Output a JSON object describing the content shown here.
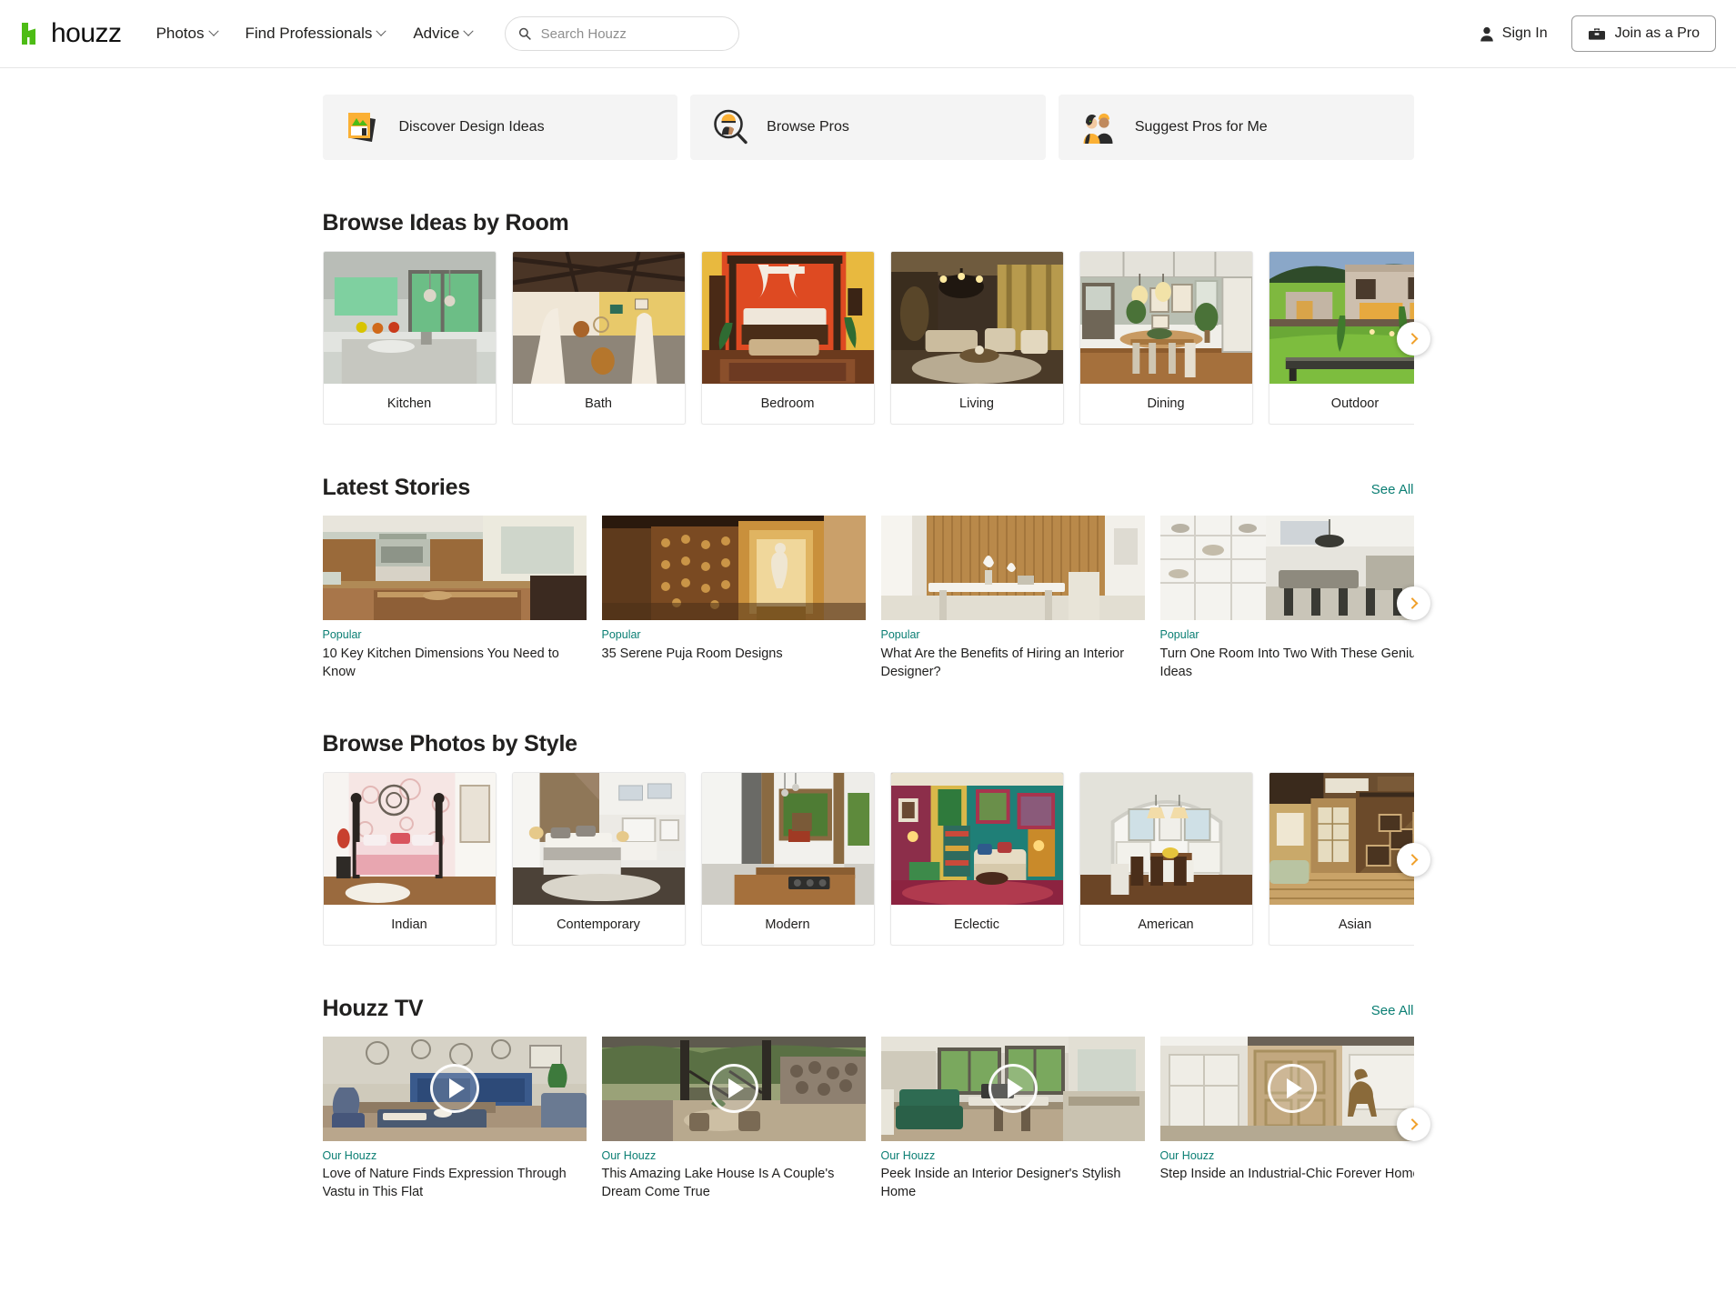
{
  "header": {
    "logo_text": "houzz",
    "nav": [
      {
        "label": "Photos",
        "has_caret": true,
        "icon": "chevron-down-icon"
      },
      {
        "label": "Find Professionals",
        "has_caret": true,
        "icon": "chevron-down-icon"
      },
      {
        "label": "Advice",
        "has_caret": true,
        "icon": "chevron-down-icon"
      }
    ],
    "search": {
      "placeholder": "Search Houzz",
      "value": "",
      "icon": "search-icon"
    },
    "sign_in": {
      "label": "Sign In",
      "icon": "person-icon"
    },
    "join_pro": {
      "label": "Join as a Pro",
      "icon": "toolbox-icon"
    }
  },
  "quick_actions": [
    {
      "label": "Discover Design Ideas",
      "icon": "photos-stack-icon"
    },
    {
      "label": "Browse Pros",
      "icon": "pro-magnifier-icon"
    },
    {
      "label": "Suggest Pros for Me",
      "icon": "two-people-icon"
    }
  ],
  "rooms_section": {
    "title": "Browse Ideas by Room",
    "next_label": "Next",
    "items": [
      {
        "label": "Kitchen"
      },
      {
        "label": "Bath"
      },
      {
        "label": "Bedroom"
      },
      {
        "label": "Living"
      },
      {
        "label": "Dining"
      },
      {
        "label": "Outdoor"
      }
    ]
  },
  "stories_section": {
    "title": "Latest Stories",
    "see_all": "See All",
    "items": [
      {
        "kicker": "Popular",
        "title": "10 Key Kitchen Dimensions You Need to Know"
      },
      {
        "kicker": "Popular",
        "title": "35 Serene Puja Room Designs"
      },
      {
        "kicker": "Popular",
        "title": "What Are the Benefits of Hiring an Interior Designer?"
      },
      {
        "kicker": "Popular",
        "title": "Turn One Room Into Two With These Genius Ideas"
      }
    ]
  },
  "styles_section": {
    "title": "Browse Photos by Style",
    "items": [
      {
        "label": "Indian"
      },
      {
        "label": "Contemporary"
      },
      {
        "label": "Modern"
      },
      {
        "label": "Eclectic"
      },
      {
        "label": "American"
      },
      {
        "label": "Asian"
      }
    ]
  },
  "tv_section": {
    "title": "Houzz TV",
    "see_all": "See All",
    "items": [
      {
        "kicker": "Our Houzz",
        "title": "Love of Nature Finds Expression Through Vastu in This Flat"
      },
      {
        "kicker": "Our Houzz",
        "title": "This Amazing Lake House Is A Couple's Dream Come True"
      },
      {
        "kicker": "Our Houzz",
        "title": "Peek Inside an Interior Designer's Stylish Home"
      },
      {
        "kicker": "Our Houzz",
        "title": "Step Inside an Industrial-Chic Forever Home"
      }
    ]
  },
  "colors": {
    "brand_green": "#4DBC15",
    "link_teal": "#0a7e73",
    "arrow_amber": "#f0a02a",
    "card_grey": "#f4f4f4",
    "text": "#21201f"
  }
}
